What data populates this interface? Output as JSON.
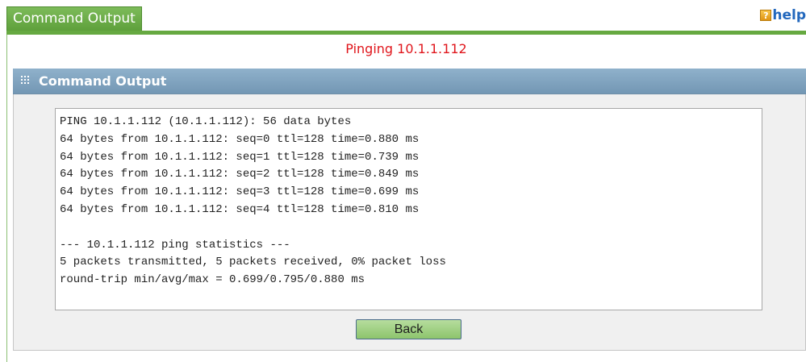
{
  "tab": {
    "label": "Command Output"
  },
  "help": {
    "icon_letter": "?",
    "label": "help"
  },
  "status": {
    "text": "Pinging 10.1.1.112"
  },
  "panel": {
    "title": "Command Output",
    "output_lines": [
      "PING 10.1.1.112 (10.1.1.112): 56 data bytes",
      "64 bytes from 10.1.1.112: seq=0 ttl=128 time=0.880 ms",
      "64 bytes from 10.1.1.112: seq=1 ttl=128 time=0.739 ms",
      "64 bytes from 10.1.1.112: seq=2 ttl=128 time=0.849 ms",
      "64 bytes from 10.1.1.112: seq=3 ttl=128 time=0.699 ms",
      "64 bytes from 10.1.1.112: seq=4 ttl=128 time=0.810 ms",
      "",
      "--- 10.1.1.112 ping statistics ---",
      "5 packets transmitted, 5 packets received, 0% packet loss",
      "round-trip min/avg/max = 0.699/0.795/0.880 ms"
    ],
    "back_label": "Back"
  },
  "colors": {
    "tab_green": "#66a941",
    "status_red": "#e0151b",
    "header_blue": "#7fa3bf",
    "help_blue": "#2368bd",
    "button_green": "#a3d285"
  },
  "icons": {
    "help": "help-icon",
    "panel_header": "grid-icon"
  }
}
